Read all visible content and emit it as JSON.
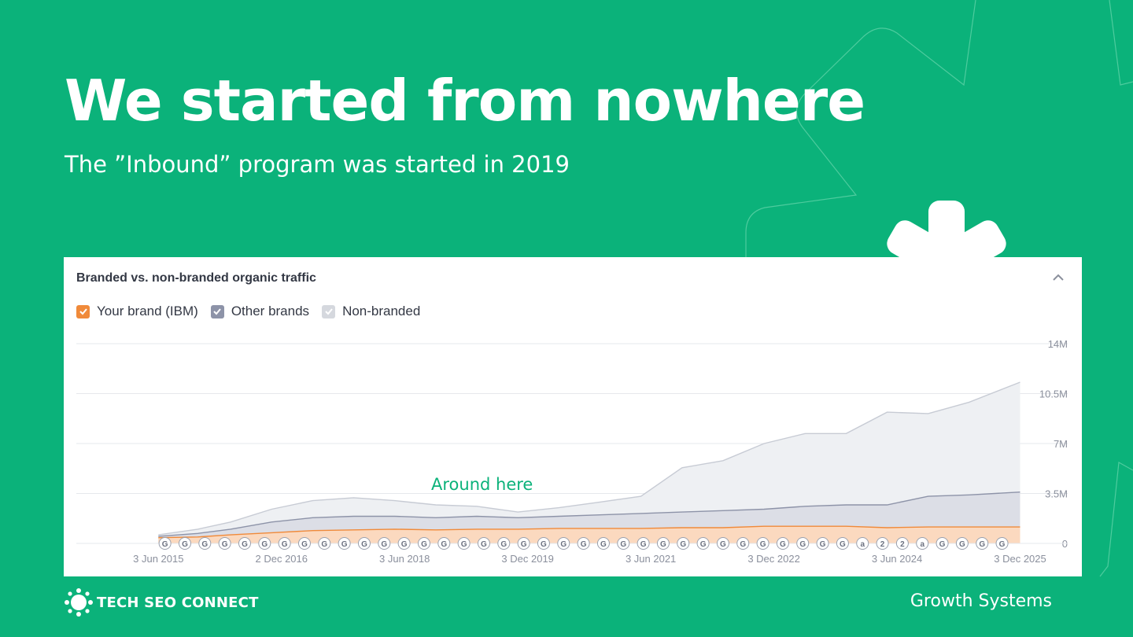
{
  "slide": {
    "title": "We started from nowhere",
    "subtitle": "The ”Inbound” program was started in 2019",
    "annotation": "Around here",
    "footer_brand": "TECH SEO CONNECT",
    "footer_right": "Growth Systems"
  },
  "colors": {
    "background": "#0bb27a",
    "brand": "#f08a3a",
    "other": "#8d93a8",
    "nonbranded": "#c7cbd4"
  },
  "chart_data": {
    "type": "area",
    "title": "Branded vs. non-branded organic traffic",
    "legend": [
      {
        "name": "Your brand (IBM)",
        "color": "#f08a3a",
        "checked": true
      },
      {
        "name": "Other brands",
        "color": "#8d93a8",
        "checked": true
      },
      {
        "name": "Non-branded",
        "color": "#c7cbd4",
        "checked": true
      }
    ],
    "legend_position": "top-left",
    "grid": true,
    "ylim": [
      0,
      14000000
    ],
    "y_ticks": [
      "0",
      "3.5M",
      "7M",
      "10.5M",
      "14M"
    ],
    "y_tick_values": [
      0,
      3500000,
      7000000,
      10500000,
      14000000
    ],
    "x_ticks": [
      "3 Jun 2015",
      "2 Dec 2016",
      "3 Jun 2018",
      "3 Dec 2019",
      "3 Jun 2021",
      "3 Dec 2022",
      "3 Jun 2024",
      "3 Dec 2025"
    ],
    "x_tick_years": [
      2015.42,
      2016.92,
      2018.42,
      2019.92,
      2021.42,
      2022.92,
      2024.42,
      2025.92
    ],
    "xlim_years": [
      2014.42,
      2026.5
    ],
    "series": [
      {
        "name": "Your brand (IBM)",
        "x": [
          2015.42,
          2015.9,
          2016.3,
          2016.8,
          2017.3,
          2017.8,
          2018.3,
          2018.8,
          2019.3,
          2019.8,
          2020.3,
          2020.8,
          2021.3,
          2021.8,
          2022.3,
          2022.8,
          2023.3,
          2023.8,
          2024.3,
          2024.8,
          2025.3,
          2025.92
        ],
        "values": [
          400000,
          450000,
          600000,
          750000,
          900000,
          950000,
          1000000,
          950000,
          1000000,
          1000000,
          1050000,
          1050000,
          1050000,
          1100000,
          1100000,
          1200000,
          1200000,
          1200000,
          1100000,
          1150000,
          1150000,
          1150000
        ]
      },
      {
        "name": "Other brands",
        "x": [
          2015.42,
          2015.9,
          2016.3,
          2016.8,
          2017.3,
          2017.8,
          2018.3,
          2018.8,
          2019.3,
          2019.8,
          2020.3,
          2020.8,
          2021.3,
          2021.8,
          2022.3,
          2022.8,
          2023.3,
          2023.8,
          2024.3,
          2024.8,
          2025.3,
          2025.92
        ],
        "values": [
          500000,
          700000,
          1000000,
          1500000,
          1800000,
          1900000,
          1900000,
          1800000,
          1900000,
          1800000,
          1900000,
          2000000,
          2100000,
          2200000,
          2300000,
          2400000,
          2600000,
          2700000,
          2700000,
          3300000,
          3400000,
          3600000
        ]
      },
      {
        "name": "Non-branded",
        "x": [
          2015.42,
          2015.9,
          2016.3,
          2016.8,
          2017.3,
          2017.8,
          2018.3,
          2018.8,
          2019.3,
          2019.8,
          2020.3,
          2020.8,
          2021.3,
          2021.8,
          2022.3,
          2022.8,
          2023.3,
          2023.8,
          2024.3,
          2024.8,
          2025.3,
          2025.92
        ],
        "values": [
          600000,
          1000000,
          1500000,
          2400000,
          3000000,
          3200000,
          3000000,
          2700000,
          2600000,
          2200000,
          2500000,
          2900000,
          3300000,
          5300000,
          5800000,
          7000000,
          7700000,
          7700000,
          9200000,
          9100000,
          9900000,
          11300000
        ]
      }
    ],
    "event_markers": [
      "G",
      "G",
      "G",
      "G",
      "G",
      "G",
      "G",
      "G",
      "G",
      "G",
      "G",
      "G",
      "G",
      "G",
      "G",
      "G",
      "G",
      "G",
      "G",
      "G",
      "G",
      "G",
      "G",
      "G",
      "G",
      "G",
      "G",
      "G",
      "G",
      "G",
      "G",
      "G",
      "G",
      "G",
      "G",
      "a",
      "2",
      "2",
      "a",
      "G",
      "G",
      "G",
      "G"
    ]
  }
}
